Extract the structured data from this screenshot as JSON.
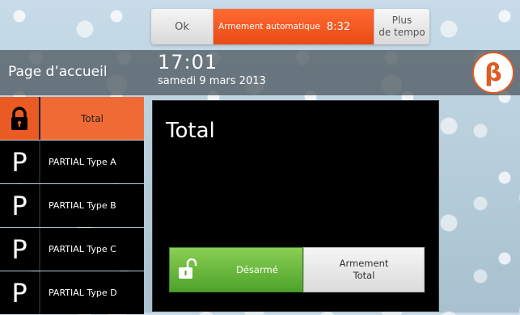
{
  "topbar": {
    "ok_label": "Ok",
    "auto_arm_label": "Armement automatique",
    "auto_arm_timer": "8:32",
    "more_time_line1": "Plus",
    "more_time_line2": "de tempo"
  },
  "header": {
    "page_title": "Page d’accueil",
    "time": "17:01",
    "date": "samedi 9 mars 2013"
  },
  "sidebar": {
    "items": [
      {
        "label": "Total",
        "icon": "lock-icon",
        "active": true
      },
      {
        "label": "PARTIAL  Type A",
        "icon": "P"
      },
      {
        "label": "PARTIAL  Type B",
        "icon": "P"
      },
      {
        "label": "PARTIAL  Type C",
        "icon": "P"
      },
      {
        "label": "PARTIAL  Type D",
        "icon": "P"
      }
    ]
  },
  "panel": {
    "title": "Total",
    "disarm_label": "Désarmé",
    "arm_line1": "Armement",
    "arm_line2": "Total"
  },
  "colors": {
    "accent_orange": "#ea5b23",
    "disarm_green": "#5aaa30"
  }
}
